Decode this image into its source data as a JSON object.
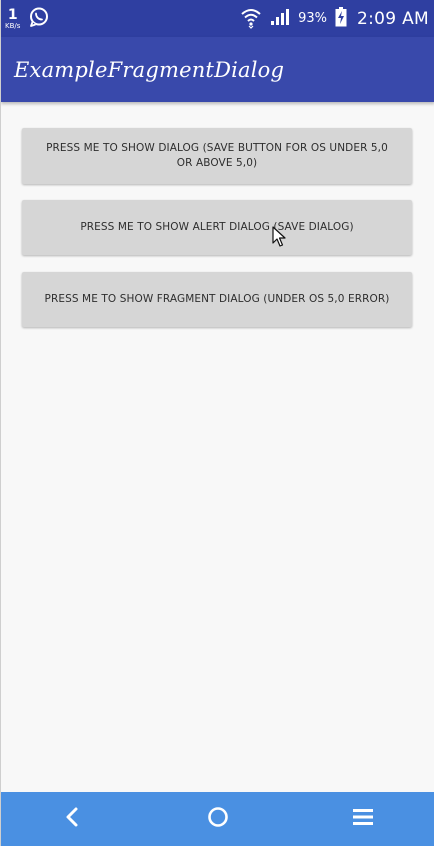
{
  "status_bar": {
    "net_speed_value": "1",
    "net_speed_unit": "KB/s",
    "battery_percent": "93%",
    "time": "2:09 AM",
    "icons": [
      "whatsapp-icon",
      "wifi-icon",
      "signal-icon",
      "battery-charging-icon"
    ]
  },
  "app_bar": {
    "title": "ExampleFragmentDialog",
    "color": "#3949ab"
  },
  "buttons": [
    {
      "label": "PRESS ME TO SHOW DIALOG (SAVE BUTTON FOR OS UNDER 5,0 OR ABOVE 5,0)"
    },
    {
      "label": "PRESS ME TO SHOW ALERT DIALOG (SAVE DIALOG)"
    },
    {
      "label": "PRESS ME TO SHOW FRAGMENT DIALOG (UNDER OS 5,0 ERROR)"
    }
  ],
  "nav_bar": {
    "color": "#4a90e2",
    "icons": [
      "back-icon",
      "home-icon",
      "menu-icon"
    ]
  }
}
